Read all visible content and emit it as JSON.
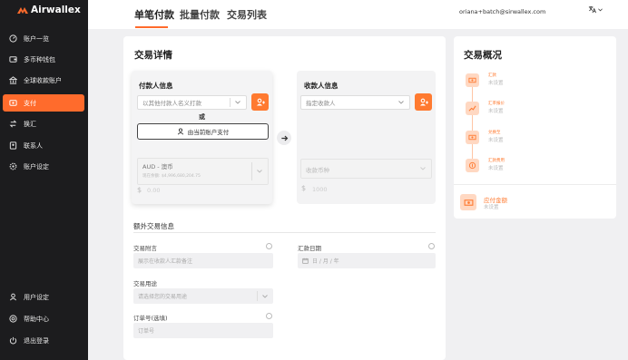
{
  "brand": {
    "name": "Airwallex",
    "accent": "#ff6b2c"
  },
  "sidebar": {
    "items": [
      {
        "label": "账户一览",
        "icon": "dashboard-icon"
      },
      {
        "label": "多币种钱包",
        "icon": "wallet-icon"
      },
      {
        "label": "全球收款账户",
        "icon": "bank-icon"
      },
      {
        "label": "支付",
        "icon": "payment-icon",
        "active": true
      },
      {
        "label": "换汇",
        "icon": "exchange-icon"
      },
      {
        "label": "联系人",
        "icon": "contacts-icon"
      },
      {
        "label": "账户设定",
        "icon": "settings-icon"
      }
    ],
    "bottom": [
      {
        "label": "用户设定",
        "icon": "user-icon"
      },
      {
        "label": "帮助中心",
        "icon": "help-icon"
      },
      {
        "label": "退出登录",
        "icon": "logout-icon"
      }
    ]
  },
  "header": {
    "tabs": [
      {
        "label": "单笔付款",
        "active": true
      },
      {
        "label": "批量付款"
      },
      {
        "label": "交易列表"
      }
    ],
    "email": "oriana+batch@sirwallex.com",
    "lang_icon": "translate-icon"
  },
  "details": {
    "title": "交易详情",
    "payer": {
      "title": "付款人信息",
      "select_placeholder": "以其他付款人名义打款",
      "or": "或",
      "pay_self_label": "由当前账户支付",
      "currency": "AUD - 澳币",
      "balance": "现在余额: $4,996,680,204.75",
      "amount_symbol": "$",
      "amount_placeholder": "0.00"
    },
    "payee": {
      "title": "收款人信息",
      "select_placeholder": "指定收款人",
      "currency_placeholder": "收款币种",
      "amount_symbol": "$",
      "amount_placeholder": "1000"
    },
    "extra": {
      "title": "额外交易信息",
      "remark_label": "交易附言",
      "remark_placeholder": "展示在收款人汇款备注",
      "date_label": "汇款日期",
      "date_placeholder": "日 / 月 / 年",
      "purpose_label": "交易用途",
      "purpose_placeholder": "请选择您的交易用途",
      "order_label": "订单号(选填)",
      "order_placeholder": "订单号"
    }
  },
  "summary": {
    "title": "交易概况",
    "steps": [
      {
        "label": "汇款",
        "value": "未设置"
      },
      {
        "label": "汇率报价",
        "value": "未设置"
      },
      {
        "label": "兑换至",
        "value": "未设置"
      },
      {
        "label": "汇款费用",
        "value": "未设置"
      }
    ],
    "total_label": "应付金额",
    "total_value": "未设置"
  }
}
